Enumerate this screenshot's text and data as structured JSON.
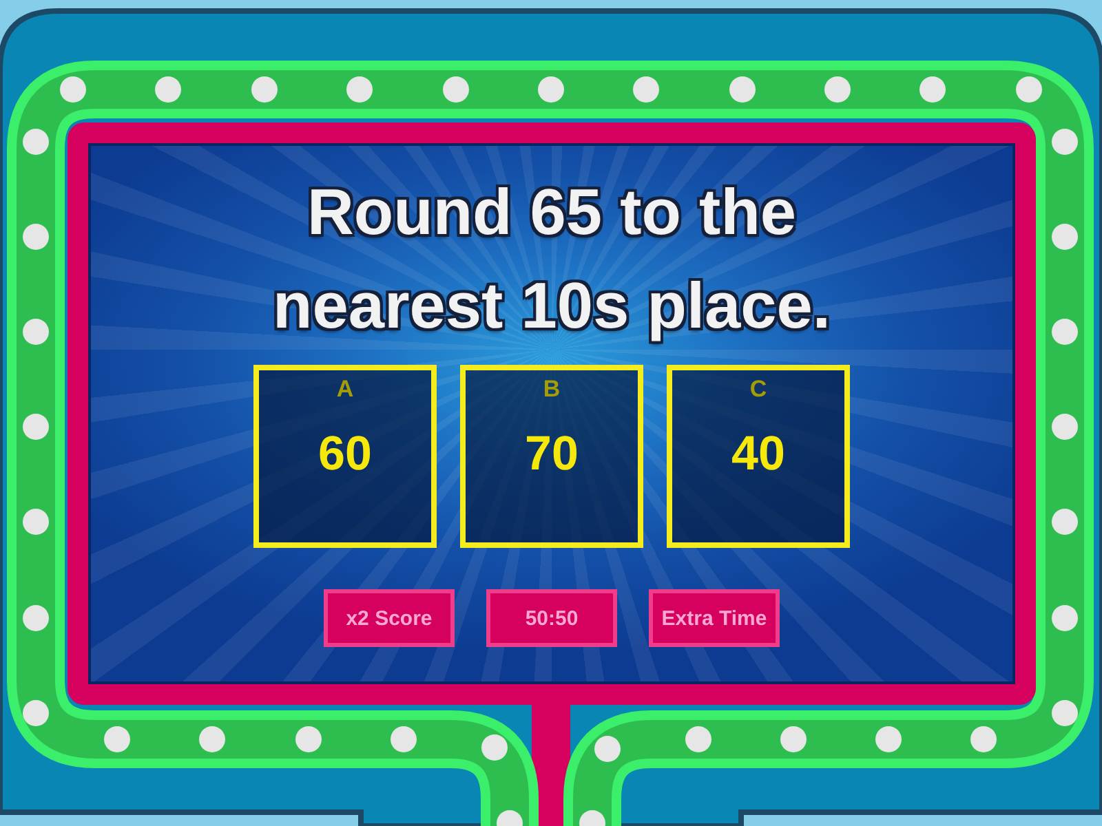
{
  "question": {
    "text": "Round 65 to the nearest 10s place."
  },
  "answers": [
    {
      "letter": "A",
      "value": "60"
    },
    {
      "letter": "B",
      "value": "70"
    },
    {
      "letter": "C",
      "value": "40"
    }
  ],
  "lifelines": [
    "x2 Score",
    "50:50",
    "Extra Time"
  ]
}
